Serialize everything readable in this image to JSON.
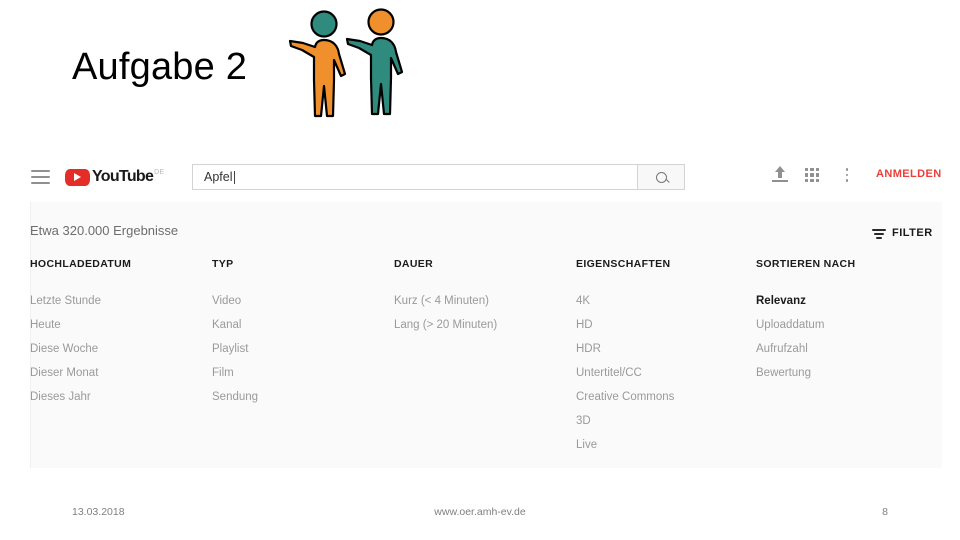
{
  "slide": {
    "title": "Aufgabe 2",
    "clipart_name": "two-stick-figures-pointing",
    "colors": {
      "figure_orange": "#f0902c",
      "figure_teal": "#2f8b7e",
      "outline": "#000000",
      "youtube_red": "#e52d27",
      "signin_red": "#e8403a",
      "panel_bg": "#fafafa"
    }
  },
  "youtube": {
    "topbar": {
      "menu_label": "Menü",
      "logo_word": "YouTube",
      "logo_country": "DE",
      "search": {
        "value": "Apfel",
        "placeholder": "Suchen",
        "button_label": "Suchen"
      },
      "upload_label": "Video hochladen",
      "apps_label": "YouTube-Apps",
      "more_label": "Weitere Optionen",
      "signin_label": "ANMELDEN"
    },
    "results_text": "Etwa 320.000 Ergebnisse",
    "filter_button_label": "FILTER",
    "columns": [
      {
        "header": "HOCHLADEDATUM",
        "options": [
          {
            "label": "Letzte Stunde",
            "active": false
          },
          {
            "label": "Heute",
            "active": false
          },
          {
            "label": "Diese Woche",
            "active": false
          },
          {
            "label": "Dieser Monat",
            "active": false
          },
          {
            "label": "Dieses Jahr",
            "active": false
          }
        ]
      },
      {
        "header": "TYP",
        "options": [
          {
            "label": "Video",
            "active": false
          },
          {
            "label": "Kanal",
            "active": false
          },
          {
            "label": "Playlist",
            "active": false
          },
          {
            "label": "Film",
            "active": false
          },
          {
            "label": "Sendung",
            "active": false
          }
        ]
      },
      {
        "header": "DAUER",
        "options": [
          {
            "label": "Kurz (< 4 Minuten)",
            "active": false
          },
          {
            "label": "Lang (> 20 Minuten)",
            "active": false
          }
        ]
      },
      {
        "header": "EIGENSCHAFTEN",
        "options": [
          {
            "label": "4K",
            "active": false
          },
          {
            "label": "HD",
            "active": false
          },
          {
            "label": "HDR",
            "active": false
          },
          {
            "label": "Untertitel/CC",
            "active": false
          },
          {
            "label": "Creative Commons",
            "active": false
          },
          {
            "label": "3D",
            "active": false
          },
          {
            "label": "Live",
            "active": false
          }
        ]
      },
      {
        "header": "SORTIEREN NACH",
        "options": [
          {
            "label": "Relevanz",
            "active": true
          },
          {
            "label": "Uploaddatum",
            "active": false
          },
          {
            "label": "Aufrufzahl",
            "active": false
          },
          {
            "label": "Bewertung",
            "active": false
          }
        ]
      }
    ]
  },
  "footer": {
    "date": "13.03.2018",
    "url": "www.oer.amh-ev.de",
    "page_number": "8"
  }
}
